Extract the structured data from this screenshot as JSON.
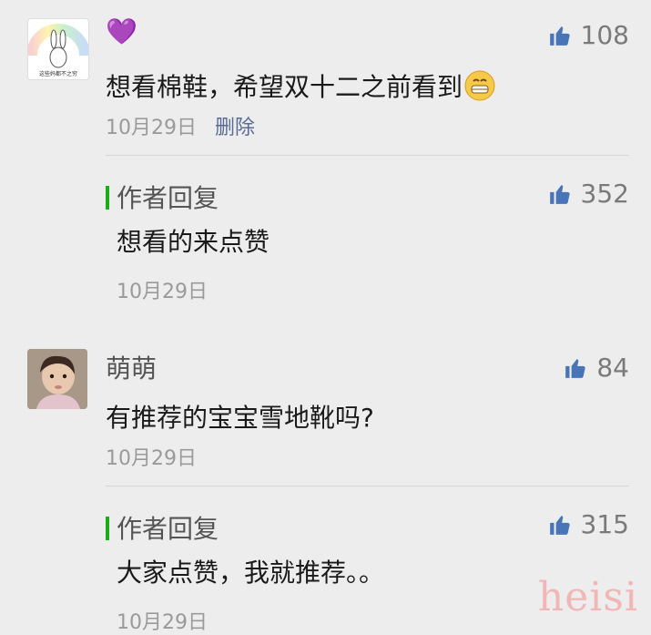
{
  "comments": [
    {
      "name": "💜",
      "likes": "108",
      "text": "想看棉鞋，希望双十二之前看到",
      "time": "10月29日",
      "delete_label": "删除",
      "avatar_caption": "这些妈都不之穷",
      "reply": {
        "title": "作者回复",
        "likes": "352",
        "text": "想看的来点赞",
        "time": "10月29日"
      }
    },
    {
      "name": "萌萌",
      "likes": "84",
      "text": "有推荐的宝宝雪地靴吗?",
      "time": "10月29日",
      "reply": {
        "title": "作者回复",
        "likes": "315",
        "text": "大家点赞，我就推荐。。",
        "time": "10月29日"
      }
    }
  ],
  "watermark": "heisi",
  "colors": {
    "reply_bar": "#1aad19",
    "link": "#576b95",
    "like": "#7a7a7a"
  }
}
